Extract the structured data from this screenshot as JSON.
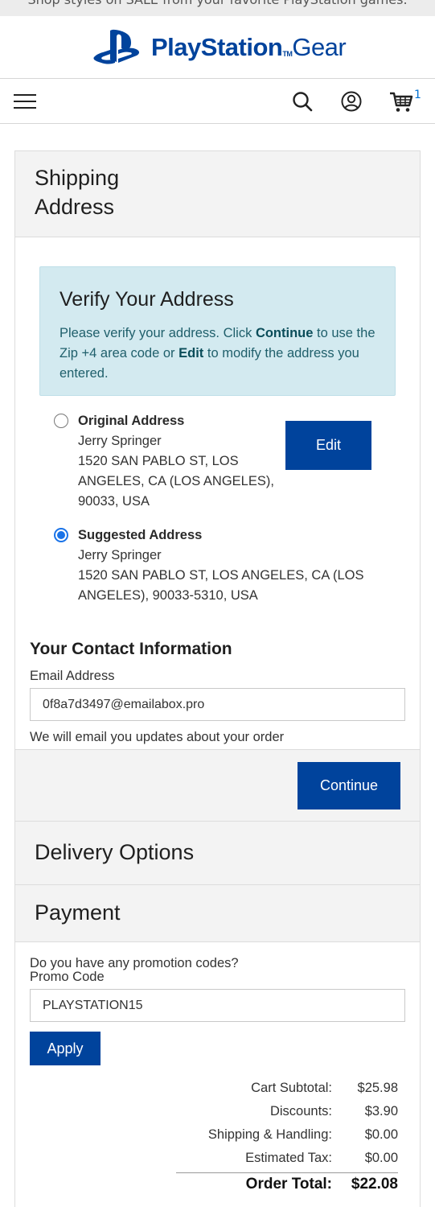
{
  "banner": {
    "text": "Shop styles on SALE from your favorite PlayStation games."
  },
  "brand": {
    "name": "PlayStation",
    "tm": "TM",
    "suffix": "Gear",
    "color": "#00439c"
  },
  "nav": {
    "menu_icon": "hamburger-icon",
    "search_icon": "search-icon",
    "account_icon": "user-icon",
    "cart_icon": "cart-icon",
    "cart_count": "1"
  },
  "shipping": {
    "title_line1": "Shipping",
    "title_line2": "Address",
    "verify": {
      "title": "Verify Your Address",
      "message_part1": "Please verify your address. Click ",
      "message_continue": "Continue",
      "message_part2": " to use the Zip +4 area code or ",
      "message_edit": "Edit",
      "message_part3": " to modify the address you entered."
    },
    "original": {
      "selected": false,
      "title": "Original Address",
      "name": "Jerry Springer",
      "line1": "1520 SAN PABLO ST, LOS",
      "line2": "ANGELES, CA (LOS ANGELES),",
      "line3": "90033, USA"
    },
    "edit_label": "Edit",
    "suggested": {
      "selected": true,
      "title": "Suggested Address",
      "name": "Jerry Springer",
      "line1": "1520 SAN PABLO ST, LOS ANGELES, CA (LOS",
      "line2": "ANGELES), 90033-5310, USA"
    }
  },
  "contact": {
    "title": "Your Contact Information",
    "email_label": "Email Address",
    "email_value": "0f8a7d3497@emailabox.pro",
    "helper": "We will email you updates about your order"
  },
  "continue_label": "Continue",
  "delivery": {
    "title": "Delivery Options"
  },
  "payment": {
    "title": "Payment",
    "promo_question": "Do you have any promotion codes?",
    "promo_label": "Promo Code",
    "promo_value": "PLAYSTATION15",
    "apply_label": "Apply"
  },
  "totals": {
    "subtotal_label": "Cart Subtotal:",
    "subtotal": "$25.98",
    "discounts_label": "Discounts:",
    "discounts": "$3.90",
    "shipping_label": "Shipping & Handling:",
    "shipping": "$0.00",
    "tax_label": "Estimated Tax:",
    "tax": "$0.00",
    "total_label": "Order Total:",
    "total": "$22.08"
  }
}
